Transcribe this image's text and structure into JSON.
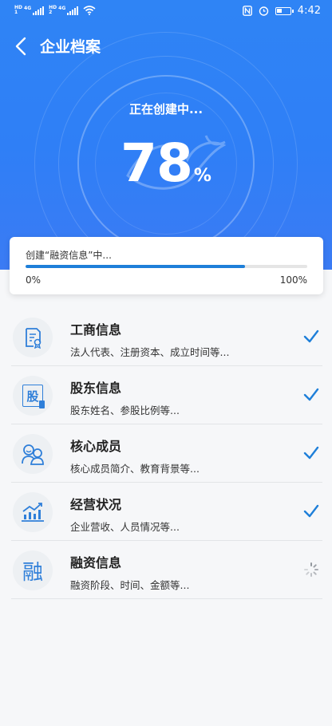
{
  "status_bar": {
    "sim1_tags": [
      "HD",
      "1"
    ],
    "sim1_net": "4G",
    "sim2_tags": [
      "HD",
      "2"
    ],
    "sim2_net": "4G",
    "time": "4:42"
  },
  "header": {
    "title": "企业档案",
    "creating_label": "正在创建中...",
    "percent_value": "78",
    "percent_unit": "%"
  },
  "progress": {
    "text": "创建“融资信息”中...",
    "fraction": 0.78,
    "min_label": "0%",
    "max_label": "100%"
  },
  "colors": {
    "primary": "#2f84f5",
    "accent": "#1e7fd9",
    "check": "#1e7fd9"
  },
  "items": [
    {
      "title": "工商信息",
      "subtitle": "法人代表、注册资本、成立时间等...",
      "icon": "license-icon",
      "status": "done"
    },
    {
      "title": "股东信息",
      "subtitle": "股东姓名、参股比例等...",
      "icon": "shareholder-icon",
      "status": "done"
    },
    {
      "title": "核心成员",
      "subtitle": "核心成员简介、教育背景等...",
      "icon": "members-icon",
      "status": "done"
    },
    {
      "title": "经营状况",
      "subtitle": "企业营收、人员情况等...",
      "icon": "chart-icon",
      "status": "done"
    },
    {
      "title": "融资信息",
      "subtitle": "融资阶段、时间、金额等...",
      "icon": "finance-icon",
      "status": "loading"
    }
  ],
  "icon_glyphs": {
    "shareholder": "股",
    "finance": "融"
  }
}
